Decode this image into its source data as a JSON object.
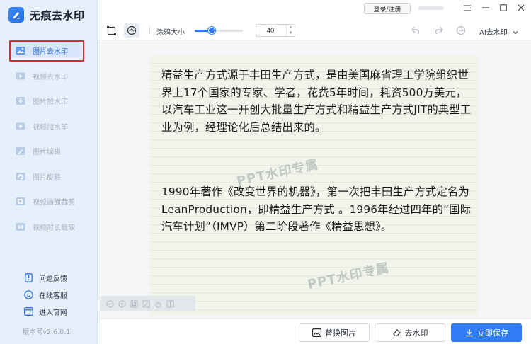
{
  "app": {
    "title": "无痕去水印",
    "version": "版本号v2.6.0.1"
  },
  "colors": {
    "accent": "#2f7cf6",
    "sidebar_bg": "#e6f0fb",
    "highlight_box": "#d72c2c"
  },
  "sidebar": {
    "items": [
      {
        "label": "图片去水印",
        "icon": "image-erase-icon",
        "active": true
      },
      {
        "label": "视频去水印",
        "icon": "video-erase-icon",
        "active": false
      },
      {
        "label": "图片加水印",
        "icon": "image-add-watermark-icon",
        "active": false
      },
      {
        "label": "视频加水印",
        "icon": "video-add-watermark-icon",
        "active": false
      },
      {
        "label": "图片编辑",
        "icon": "image-edit-icon",
        "active": false
      },
      {
        "label": "图片旋转",
        "icon": "image-rotate-icon",
        "active": false
      },
      {
        "label": "视频画面裁剪",
        "icon": "video-crop-icon",
        "active": false
      },
      {
        "label": "视频时长截取",
        "icon": "video-trim-icon",
        "active": false
      }
    ],
    "bottom_links": [
      {
        "label": "问题反馈",
        "icon": "feedback-icon"
      },
      {
        "label": "在线客服",
        "icon": "customer-service-icon"
      },
      {
        "label": "进入官网",
        "icon": "website-icon"
      }
    ]
  },
  "titlebar": {
    "login_label": "登录/注册"
  },
  "toolbar": {
    "brush_size_label": "涂鸦大小",
    "brush_size_value": "40",
    "brush_level": 0.35,
    "ai_remove_label": "AI去水印"
  },
  "document": {
    "paragraph1": "精益生产方式源于丰田生产方式，是由美国麻省理工学院组织世界上17个国家的专家、学者，花费5年时间，耗资500万美元，以汽车工业这一开创大批量生产方式和精益生产方式JIT的典型工业为例，经理论化后总结出来的。",
    "paragraph2": "1990年著作《改变世界的机器》，第一次把丰田生产方式定名为 LeanProduction，即精益生产方式 。1996年经过四年的“国际汽车计划”（IMVP）第二阶段著作《精益思想》。",
    "watermark1": "PPT水印专属",
    "watermark2": "PPT水印专属"
  },
  "bottom": {
    "replace_label": "替换图片",
    "remove_label": "去水印",
    "save_label": "立即保存"
  }
}
